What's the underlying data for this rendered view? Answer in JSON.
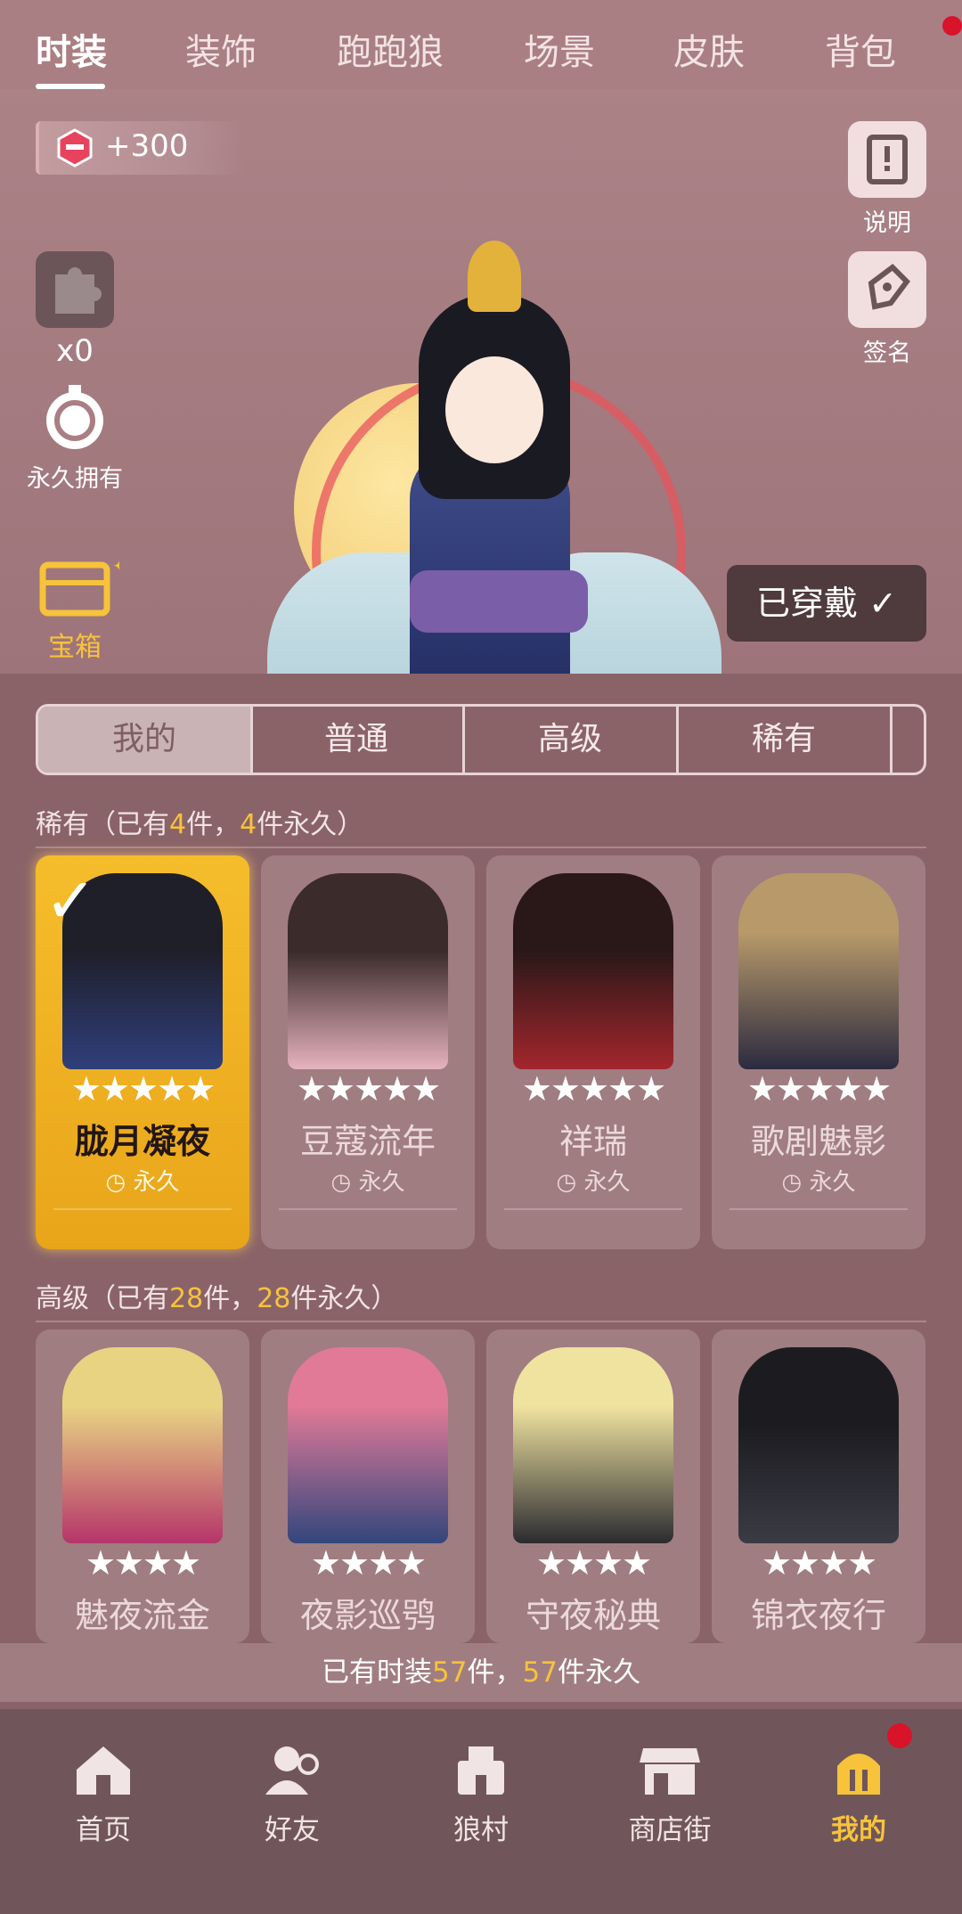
{
  "top_tabs": [
    "时装",
    "装饰",
    "跑跑狼",
    "场景",
    "皮肤",
    "背包"
  ],
  "currency": {
    "amount": "+300"
  },
  "side_buttons": {
    "puzzle_count": "x0",
    "permanent": "永久拥有",
    "chest": "宝箱",
    "explain": "说明",
    "sign": "签名"
  },
  "worn_button": "已穿戴 ✓",
  "rarity_tabs": [
    "我的",
    "普通",
    "高级",
    "稀有"
  ],
  "section_rare": {
    "prefix": "稀有（已有",
    "count": "4",
    "mid": "件，",
    "perm": "4",
    "suffix": "件永久）"
  },
  "section_adv": {
    "prefix": "高级（已有",
    "count": "28",
    "mid": "件，",
    "perm": "28",
    "suffix": "件永久）"
  },
  "rare_cards": [
    {
      "name": "胧月凝夜",
      "stars": "★★★★★",
      "perm": "永久"
    },
    {
      "name": "豆蔻流年",
      "stars": "★★★★★",
      "perm": "永久"
    },
    {
      "name": "祥瑞",
      "stars": "★★★★★",
      "perm": "永久"
    },
    {
      "name": "歌剧魅影",
      "stars": "★★★★★",
      "perm": "永久"
    }
  ],
  "adv_cards": [
    {
      "name": "魅夜流金",
      "stars": "★★★★"
    },
    {
      "name": "夜影巡鸮",
      "stars": "★★★★"
    },
    {
      "name": "守夜秘典",
      "stars": "★★★★"
    },
    {
      "name": "锦衣夜行",
      "stars": "★★★★"
    }
  ],
  "summary": {
    "prefix": "已有时装",
    "count": "57",
    "mid": "件，",
    "perm": "57",
    "suffix": "件永久"
  },
  "bottom_nav": [
    "首页",
    "好友",
    "狼村",
    "商店街",
    "我的"
  ],
  "colors": {
    "accent": "#f6c33b",
    "badge": "#d9132a",
    "nav_bg": "#70565a"
  }
}
